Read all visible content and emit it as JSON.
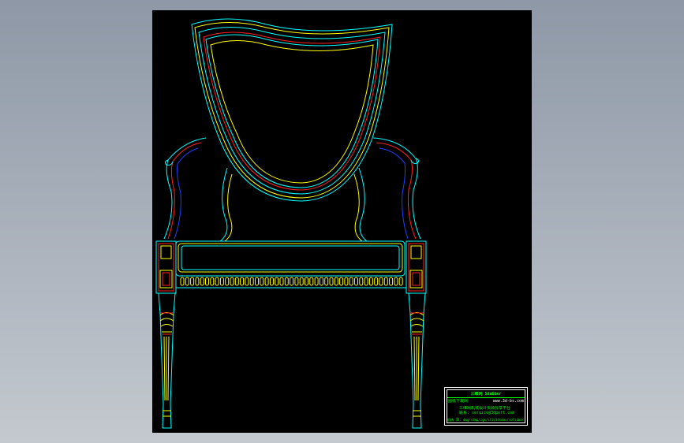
{
  "drawing": {
    "background": "#000000",
    "line_colors": {
      "cyan": "#00ffff",
      "yellow": "#ffff00",
      "red": "#ff2020",
      "blue": "#2040ff",
      "white": "#ffffff",
      "green": "#00ff00"
    }
  },
  "title_block": {
    "brand": "三维网 Sdabber",
    "url_left": "图纸下载网",
    "url_right": "www.3d-bs.com",
    "line_a": "三维网机械设计资源分享平台",
    "line_b": "联系: service@3dport.com",
    "line_c": "机械 3D: dwg/step/igs/stl/3dsmax/solidworks 图纸下载与分享"
  }
}
